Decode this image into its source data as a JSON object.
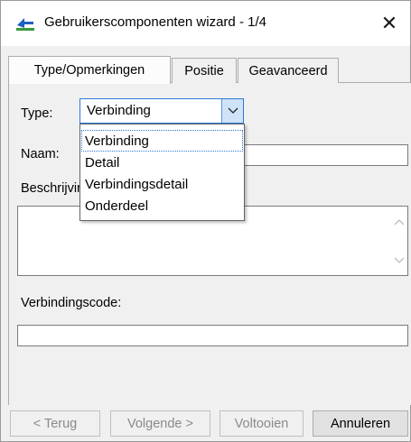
{
  "window": {
    "title": "Gebruikerscomponenten wizard - 1/4",
    "close_glyph": "✕",
    "app_icon": "component-wizard-icon"
  },
  "tabs": [
    {
      "label": "Type/Opmerkingen",
      "active": true
    },
    {
      "label": "Positie",
      "active": false
    },
    {
      "label": "Geavanceerd",
      "active": false
    }
  ],
  "form": {
    "type_label": "Type:",
    "type_value": "Verbinding",
    "naam_label": "Naam:",
    "naam_value": "",
    "beschrijving_label": "Beschrijving:",
    "beschrijving_value": "",
    "code_label": "Verbindingscode:",
    "code_value": ""
  },
  "dropdown": {
    "open": true,
    "options": [
      "Verbinding",
      "Detail",
      "Verbindingsdetail",
      "Onderdeel"
    ],
    "selected_index": 0
  },
  "buttons": {
    "back": {
      "label": "< Terug",
      "enabled": false
    },
    "next": {
      "label": "Volgende >",
      "enabled": false
    },
    "finish": {
      "label": "Voltooien",
      "enabled": false
    },
    "cancel": {
      "label": "Annuleren",
      "enabled": true
    }
  },
  "colors": {
    "accent": "#2b7ad6",
    "icon_blue": "#1f5fbf",
    "icon_green": "#3a9a3a"
  }
}
